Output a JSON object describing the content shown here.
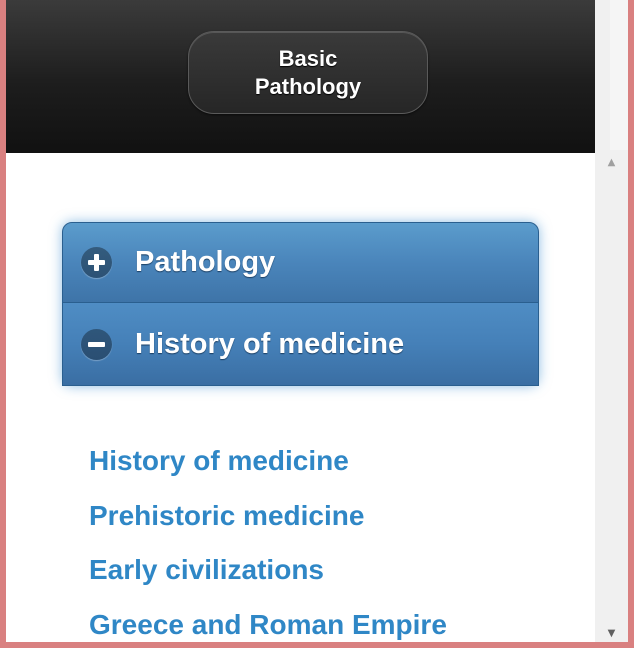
{
  "header": {
    "title_line1": "Basic",
    "title_line2": "Pathology"
  },
  "accordion": {
    "items": [
      {
        "label": "Pathology",
        "icon": "plus-icon",
        "expanded": false
      },
      {
        "label": "History of medicine",
        "icon": "minus-icon",
        "expanded": true
      }
    ]
  },
  "links": [
    "History of medicine",
    "Prehistoric medicine",
    "Early civilizations",
    "Greece and Roman Empire"
  ],
  "scrollbar": {
    "up_arrow": "▲",
    "down_arrow": "▼"
  },
  "colors": {
    "header": "#1d1d1d",
    "accordion_blue": "#4a85bb",
    "link_blue": "#2f87c6",
    "window_border": "#d98080"
  }
}
